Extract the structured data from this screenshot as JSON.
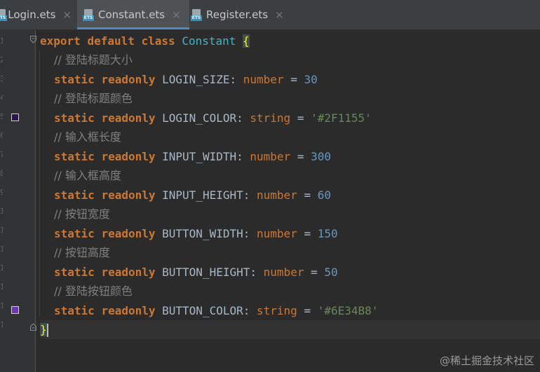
{
  "tabs": [
    {
      "label": "Login.ets",
      "close": "×",
      "icon": "ets-file-icon",
      "icon_badge": "ETS"
    },
    {
      "label": "Constant.ets",
      "close": "×",
      "icon": "ets-file-icon",
      "icon_badge": "ETS",
      "active": true
    },
    {
      "label": "Register.ets",
      "close": "×",
      "icon": "ets-file-icon",
      "icon_badge": "ETS"
    }
  ],
  "gutter": {
    "line_numbers": [
      "1",
      "2",
      "3",
      "4",
      "5",
      "6",
      "7",
      "8",
      "9",
      "10",
      "11",
      "12",
      "13",
      "14",
      "15",
      "16"
    ],
    "color_swatches": [
      "#2F1155",
      "#6E34B8"
    ]
  },
  "code": {
    "class_decl": {
      "export": "export",
      "default": "default",
      "class": "class",
      "name": "Constant",
      "open": "{"
    },
    "lines": {
      "c1": "// 登陆标题大小",
      "c2": "// 登陆标题颜色",
      "c3": "// 输入框长度",
      "c4": "// 输入框高度",
      "c5": "// 按钮宽度",
      "c6": "// 按钮高度",
      "c7": "// 登陆按钮颜色"
    },
    "kw_static": "static",
    "kw_readonly": "readonly",
    "fields": [
      {
        "name": "LOGIN_SIZE",
        "colon": ":",
        "type": "number",
        "eq": "=",
        "value": "30"
      },
      {
        "name": "LOGIN_COLOR",
        "colon": ":",
        "type": "string",
        "eq": "=",
        "value": "'#2F1155'"
      },
      {
        "name": "INPUT_WIDTH",
        "colon": ":",
        "type": "number",
        "eq": "=",
        "value": "300"
      },
      {
        "name": "INPUT_HEIGHT",
        "colon": ":",
        "type": "number",
        "eq": "=",
        "value": "60"
      },
      {
        "name": "BUTTON_WIDTH",
        "colon": ":",
        "type": "number",
        "eq": "=",
        "value": "150"
      },
      {
        "name": "BUTTON_HEIGHT",
        "colon": ":",
        "type": "number",
        "eq": "=",
        "value": "50"
      },
      {
        "name": "BUTTON_COLOR",
        "colon": ":",
        "type": "string",
        "eq": "=",
        "value": "'#6E34B8'"
      }
    ],
    "close": "}"
  },
  "watermark": "@稀土掘金技术社区",
  "colors": {
    "keyword": "#cc7832",
    "class_name": "#3fb5c8",
    "number": "#6897bb",
    "string": "#6a8759",
    "comment": "#808080",
    "brace_match": "#ffef28",
    "tab_accent": "#4a88c7"
  }
}
